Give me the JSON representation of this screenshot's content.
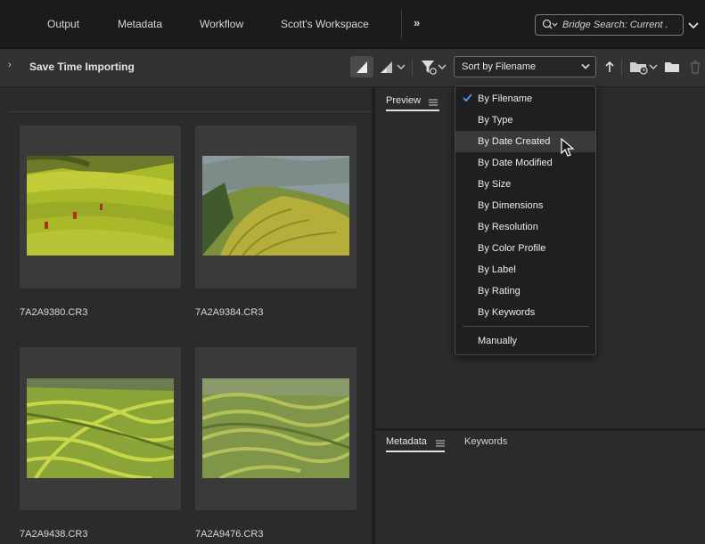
{
  "workspace_tabs": [
    "Output",
    "Metadata",
    "Workflow",
    "Scott's Workspace"
  ],
  "more_glyph": "»",
  "search": {
    "value": "Bridge Search: Current .",
    "icon": "search-icon"
  },
  "path": {
    "chevron": "›",
    "folder": "Save Time Importing"
  },
  "sort": {
    "selected": "Sort by Filename"
  },
  "sort_menu": {
    "items": [
      "By Filename",
      "By Type",
      "By Date Created",
      "By Date Modified",
      "By Size",
      "By Dimensions",
      "By Resolution",
      "By Color Profile",
      "By Label",
      "By Rating",
      "By Keywords"
    ],
    "manual": "Manually",
    "checked": "By Filename",
    "hovered": "By Date Created"
  },
  "thumbnails": [
    {
      "name": "7A2A9380.CR3"
    },
    {
      "name": "7A2A9384.CR3"
    },
    {
      "name": "7A2A9438.CR3"
    },
    {
      "name": "7A2A9476.CR3"
    }
  ],
  "panels": {
    "preview": "Preview",
    "metadata": "Metadata",
    "keywords": "Keywords"
  },
  "colors": {
    "accent_blue": "#4a9cff",
    "panel_bg": "#2b2b2b",
    "topbar_bg": "#1b1b1b",
    "menu_bg": "#1f1f1f"
  }
}
